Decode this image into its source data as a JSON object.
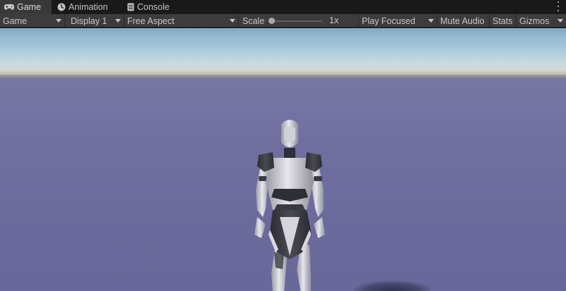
{
  "tabs": [
    {
      "label": "Game",
      "icon": "gamepad-icon",
      "active": true
    },
    {
      "label": "Animation",
      "icon": "clock-icon",
      "active": false
    },
    {
      "label": "Console",
      "icon": "console-icon",
      "active": false
    }
  ],
  "toolbar": {
    "view_mode": "Game",
    "display": "Display 1",
    "aspect": "Free Aspect",
    "scale_label": "Scale",
    "scale_value": "1x",
    "scale_slider_fraction": 0.0,
    "play_mode": "Play Focused",
    "mute_audio": "Mute Audio",
    "stats": "Stats",
    "gizmos": "Gizmos"
  },
  "colors": {
    "tab_active_bg": "#383838",
    "toolbar_bg": "#3c3c3c",
    "ground": "#6e6f9e",
    "sky": "#a7c8da"
  }
}
